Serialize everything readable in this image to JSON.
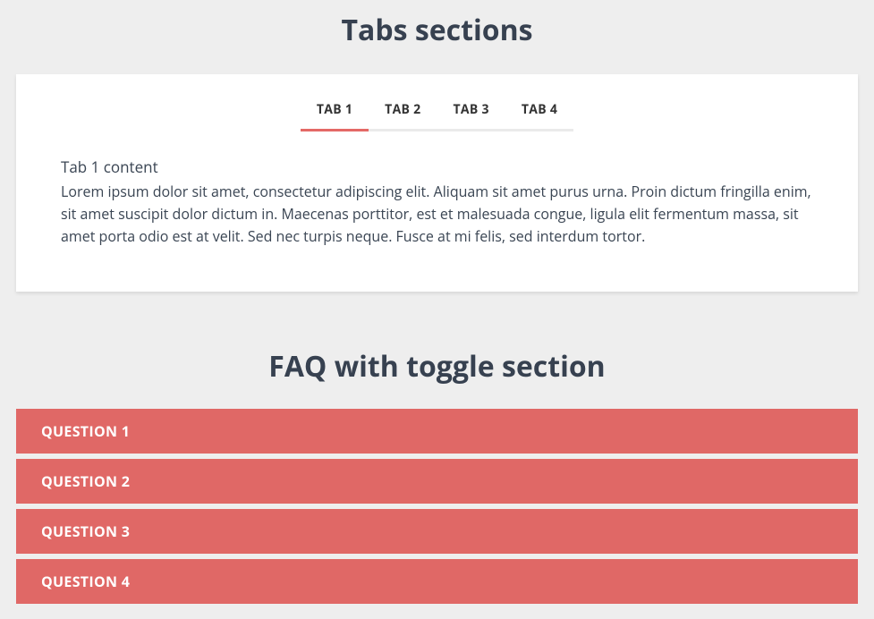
{
  "sections": {
    "tabs_title": "Tabs sections",
    "faq_title": "FAQ with toggle section"
  },
  "tabs": {
    "items": [
      {
        "label": "TAB 1",
        "active": true
      },
      {
        "label": "TAB 2",
        "active": false
      },
      {
        "label": "TAB 3",
        "active": false
      },
      {
        "label": "TAB 4",
        "active": false
      }
    ],
    "content": {
      "title": "Tab 1 content",
      "body": "Lorem ipsum dolor sit amet, consectetur adipiscing elit. Aliquam sit amet purus urna. Proin dictum fringilla enim, sit amet suscipit dolor dictum in. Maecenas porttitor, est et malesuada congue, ligula elit fermentum massa, sit amet porta odio est at velit. Sed nec turpis neque. Fusce at mi felis, sed interdum tortor."
    }
  },
  "faq": {
    "items": [
      {
        "label": "QUESTION 1"
      },
      {
        "label": "QUESTION 2"
      },
      {
        "label": "QUESTION 3"
      },
      {
        "label": "QUESTION 4"
      }
    ]
  },
  "colors": {
    "accent": "#e46966",
    "background": "#eeeeee",
    "card": "#ffffff"
  }
}
